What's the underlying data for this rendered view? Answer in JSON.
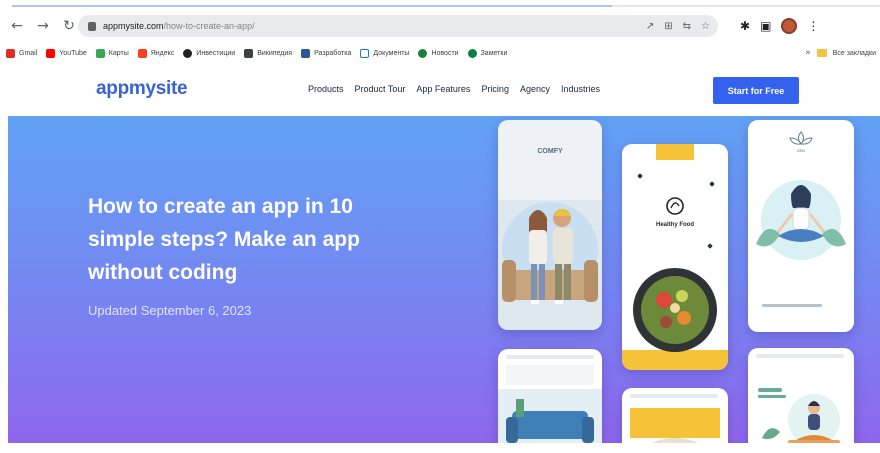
{
  "browser": {
    "url_host": "appmysite.com",
    "url_path": "/how-to-create-an-app/",
    "nav_icons": [
      "back-arrow-icon",
      "forward-arrow-icon",
      "reload-icon"
    ],
    "bookmarks": [
      {
        "label": "Gmail",
        "color": "#d93025"
      },
      {
        "label": "YouTube",
        "color": "#ff0000"
      },
      {
        "label": "Карты",
        "color": "#34a853"
      },
      {
        "label": "Яндекс",
        "color": "#fc3f1d"
      },
      {
        "label": "Инвестиции",
        "color": "#202124"
      },
      {
        "label": "Википедия",
        "color": "#3c4043"
      },
      {
        "label": "Разработка",
        "color": "#2b5797"
      },
      {
        "label": "Документы",
        "color": "#1a73e8"
      },
      {
        "label": "Новости",
        "color": "#188038"
      },
      {
        "label": "Заметки",
        "color": "#0b8043"
      }
    ],
    "bookmarks_more": "Все закладки"
  },
  "site": {
    "logo": "appmysite",
    "nav": [
      "Products",
      "Product Tour",
      "App Features",
      "Pricing",
      "Agency",
      "Industries"
    ],
    "cta": "Start for Free"
  },
  "hero": {
    "title": "How to create an app in 10 simple steps? Make an app without coding",
    "date": "Updated September 6, 2023",
    "gradient": [
      "#62a2f5",
      "#8f66ec"
    ]
  },
  "phones": {
    "p1_brand": "COMFY",
    "p2_brand": "Healthy Food",
    "p3_brand": "ZEN"
  },
  "colors": {
    "accent": "#3461ee",
    "logo": "#3a63d8"
  }
}
